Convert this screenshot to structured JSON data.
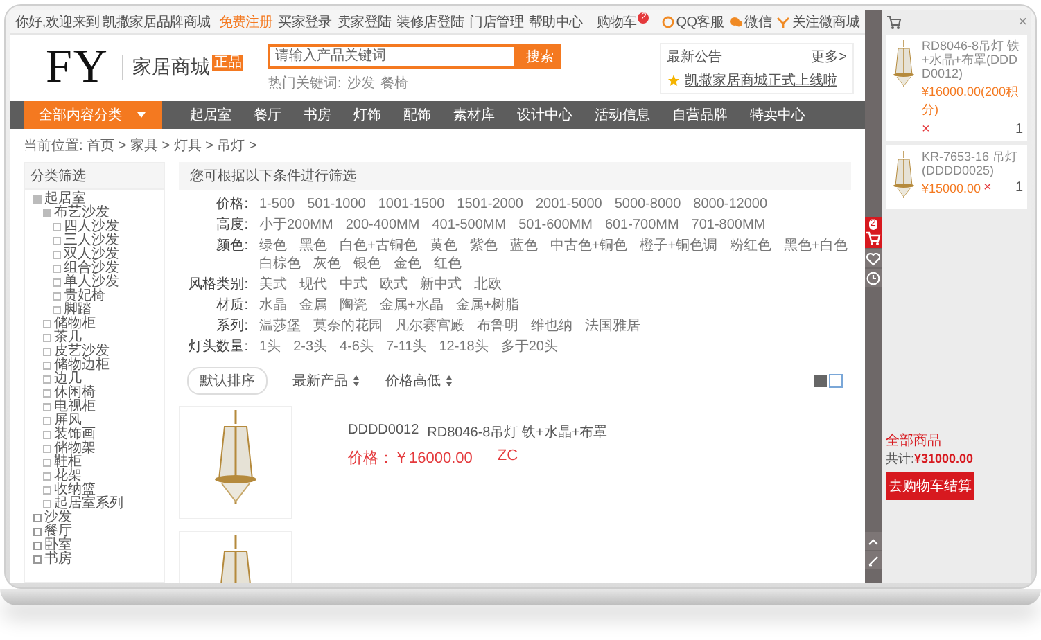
{
  "top_bar": {
    "greeting": "你好,欢迎来到 凯撒家居品牌商城",
    "links": [
      {
        "label": "免费注册",
        "highlighted": true
      },
      {
        "label": "买家登录",
        "highlighted": false
      },
      {
        "label": "卖家登陆",
        "highlighted": false
      },
      {
        "label": "装修店登陆",
        "highlighted": false
      },
      {
        "label": "门店管理",
        "highlighted": false
      },
      {
        "label": "帮助中心",
        "highlighted": false
      }
    ],
    "cart": {
      "label": "购物车",
      "badge": "2"
    },
    "services": [
      {
        "kind": "qq",
        "label": "QQ客服"
      },
      {
        "kind": "wechat",
        "label": "微信"
      },
      {
        "kind": "follow",
        "label": "关注微商城"
      }
    ]
  },
  "header": {
    "logo": "FY",
    "site_name": "家居商城",
    "badge": "正品",
    "search": {
      "placeholder": "请输入产品关键词",
      "button": "搜索"
    },
    "hot_keywords": {
      "label": "热门关键词:",
      "items": [
        "沙发",
        "餐椅"
      ]
    },
    "notice": {
      "title": "最新公告",
      "more": "更多>",
      "text": "凯撒家居商城正式上线啦"
    }
  },
  "nav": {
    "category_button": "全部内容分类",
    "items": [
      "起居室",
      "餐厅",
      "书房",
      "灯饰",
      "配饰",
      "素材库",
      "设计中心",
      "活动信息",
      "自营品牌",
      "特卖中心"
    ]
  },
  "breadcrumb": "当前位置: 首页 > 家具 > 灯具 > 吊灯 >",
  "sidebar": {
    "title": "分类筛选",
    "tree": [
      {
        "label": "起居室",
        "expanded": true,
        "children": [
          {
            "label": "布艺沙发",
            "expanded": true,
            "children": [
              {
                "label": "四人沙发"
              },
              {
                "label": "三人沙发"
              },
              {
                "label": "双人沙发"
              },
              {
                "label": "组合沙发"
              },
              {
                "label": "单人沙发"
              },
              {
                "label": "贵妃椅"
              },
              {
                "label": "脚踏"
              }
            ]
          },
          {
            "label": "储物柜"
          },
          {
            "label": "茶几"
          },
          {
            "label": "皮艺沙发"
          },
          {
            "label": "储物边柜"
          },
          {
            "label": "边几"
          },
          {
            "label": "休闲椅"
          },
          {
            "label": "电视柜"
          },
          {
            "label": "屏风"
          },
          {
            "label": "装饰画"
          },
          {
            "label": "储物架"
          },
          {
            "label": "鞋柜"
          },
          {
            "label": "花架"
          },
          {
            "label": "收纳篮"
          },
          {
            "label": "起居室系列"
          }
        ]
      },
      {
        "label": "沙发",
        "expanded": false
      },
      {
        "label": "餐厅",
        "expanded": false
      },
      {
        "label": "卧室",
        "expanded": false
      },
      {
        "label": "书房",
        "expanded": false
      }
    ]
  },
  "filters": {
    "title": "您可根据以下条件进行筛选",
    "rows": [
      {
        "label": "价格:",
        "options": [
          "1-500",
          "501-1000",
          "1001-1500",
          "1501-2000",
          "2001-5000",
          "5000-8000",
          "8000-12000"
        ]
      },
      {
        "label": "高度:",
        "options": [
          "小于200MM",
          "200-400MM",
          "401-500MM",
          "501-600MM",
          "601-700MM",
          "701-800MM"
        ]
      },
      {
        "label": "颜色:",
        "options": [
          "绿色",
          "黑色",
          "白色+古铜色",
          "黄色",
          "紫色",
          "蓝色",
          "中古色+铜色",
          "橙子+铜色调",
          "粉红色",
          "黑色+白色",
          "白棕色",
          "灰色",
          "银色",
          "金色",
          "红色"
        ]
      },
      {
        "label": "风格类别:",
        "options": [
          "美式",
          "现代",
          "中式",
          "欧式",
          "新中式",
          "北欧"
        ]
      },
      {
        "label": "材质:",
        "options": [
          "水晶",
          "金属",
          "陶瓷",
          "金属+水晶",
          "金属+树脂"
        ]
      },
      {
        "label": "系列:",
        "options": [
          "温莎堡",
          "莫奈的花园",
          "凡尔赛宫殿",
          "布鲁明",
          "维也纳",
          "法国雅居"
        ]
      },
      {
        "label": "灯头数量:",
        "options": [
          "1头",
          "2-3头",
          "4-6头",
          "7-11头",
          "12-18头",
          "多于20头"
        ]
      }
    ]
  },
  "sort": {
    "options": [
      {
        "label": "默认排序",
        "selected": true
      },
      {
        "label": "最新产品",
        "selected": false
      },
      {
        "label": "价格高低",
        "selected": false
      }
    ]
  },
  "products": [
    {
      "code": "DDDD0012",
      "name": "RD8046-8吊灯 铁+水晶+布罩",
      "price": "价格：￥16000.00",
      "tag": "ZC"
    }
  ],
  "cart_panel": {
    "items": [
      {
        "name": "RD8046-8吊灯 铁+水晶+布罩(DDDD0012)",
        "price": "¥16000.00(200积分)",
        "remove": "×",
        "quantity": "1"
      },
      {
        "name": "KR-7653-16 吊灯(DDDD0025)",
        "price": "¥15000.00",
        "remove": "×",
        "quantity": "1"
      }
    ],
    "close": "×",
    "summary_label": "全部商品",
    "total_label": "共计:",
    "total": "¥31000.00",
    "checkout": "去购物车结算"
  },
  "toolbar": {
    "cart_badge": "2"
  }
}
